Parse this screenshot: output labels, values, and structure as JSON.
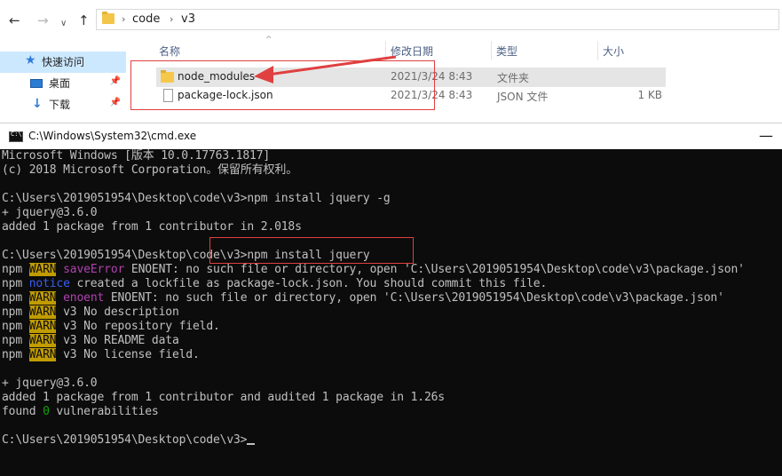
{
  "explorer": {
    "breadcrumb": [
      "code",
      "v3"
    ],
    "sidebar": [
      {
        "label": "快速访问",
        "icon": "star-icon"
      },
      {
        "label": "桌面",
        "icon": "desktop-icon"
      },
      {
        "label": "下载",
        "icon": "download-icon"
      }
    ],
    "columns": {
      "name": "名称",
      "date": "修改日期",
      "type": "类型",
      "size": "大小"
    },
    "files": [
      {
        "name": "node_modules",
        "date": "2021/3/24 8:43",
        "type": "文件夹",
        "size": ""
      },
      {
        "name": "package-lock.json",
        "date": "2021/3/24 8:43",
        "type": "JSON 文件",
        "size": "1 KB"
      }
    ]
  },
  "cmd": {
    "title": "C:\\Windows\\System32\\cmd.exe",
    "lines": {
      "l1": "Microsoft Windows [版本 10.0.17763.1817]",
      "l2": "(c) 2018 Microsoft Corporation。保留所有权利。",
      "l4": "C:\\Users\\2019051954\\Desktop\\code\\v3>npm install jquery -g",
      "l5": "+ jquery@3.6.0",
      "l6": "added 1 package from 1 contributor in 2.018s",
      "l8": "C:\\Users\\2019051954\\Desktop\\code\\v3>npm install jquery",
      "npm": "npm",
      "warn": "WARN",
      "notice": "notice",
      "l9_tag": "saveError",
      "l9_rest": " ENOENT: no such file or directory, open 'C:\\Users\\2019051954\\Desktop\\code\\v3\\package.json'",
      "l10_rest": " created a lockfile as package-lock.json. You should commit this file.",
      "l11_tag": "enoent",
      "l11_rest": " ENOENT: no such file or directory, open 'C:\\Users\\2019051954\\Desktop\\code\\v3\\package.json'",
      "l12_rest": " v3 No description",
      "l13_rest": " v3 No repository field.",
      "l14_rest": " v3 No README data",
      "l15_rest": " v3 No license field.",
      "l17": "+ jquery@3.6.0",
      "l18": "added 1 package from 1 contributor and audited 1 package in 1.26s",
      "l19_a": "found ",
      "l19_n": "0",
      "l19_b": " vulnerabilities",
      "l21": "C:\\Users\\2019051954\\Desktop\\code\\v3>"
    }
  }
}
